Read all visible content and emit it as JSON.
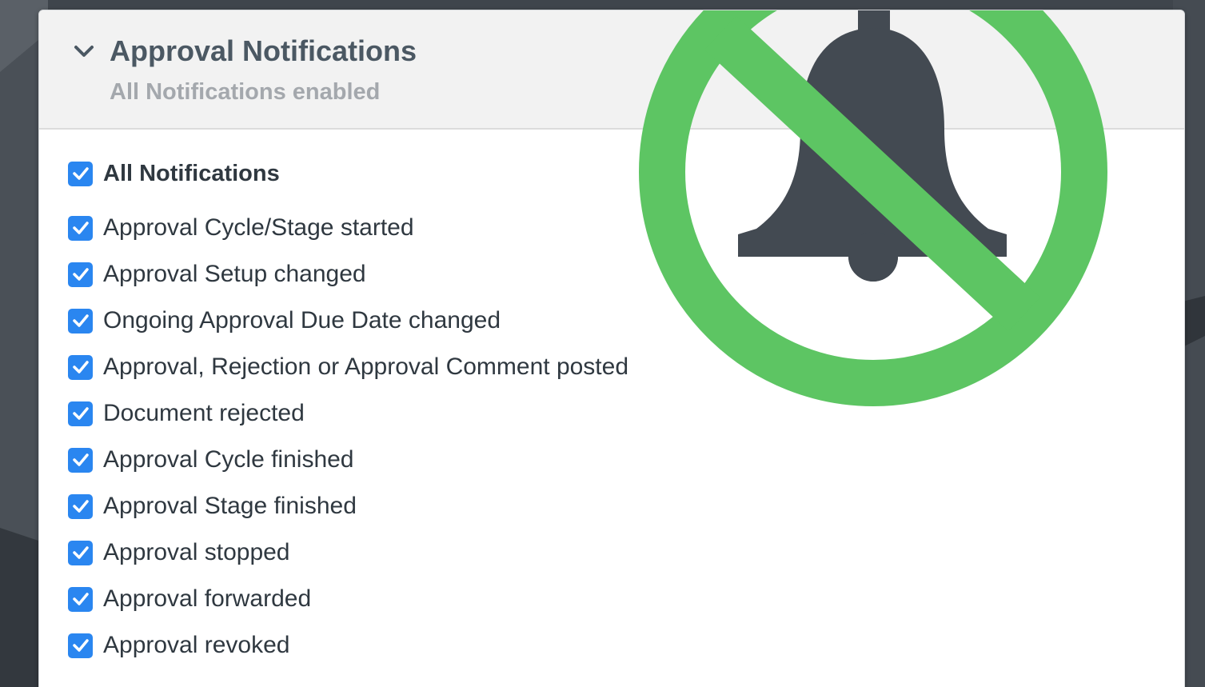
{
  "panel": {
    "title": "Approval Notifications",
    "subtitle": "All Notifications enabled",
    "collapse_icon": "chevron-down-icon"
  },
  "notifications": [
    {
      "label": "All Notifications",
      "checked": true,
      "bold": true
    },
    {
      "label": "Approval Cycle/Stage started",
      "checked": true
    },
    {
      "label": "Approval Setup changed",
      "checked": true
    },
    {
      "label": "Ongoing Approval Due Date changed",
      "checked": true
    },
    {
      "label": "Approval, Rejection or Approval Comment posted",
      "checked": true
    },
    {
      "label": "Document rejected",
      "checked": true
    },
    {
      "label": "Approval Cycle finished",
      "checked": true
    },
    {
      "label": "Approval Stage finished",
      "checked": true
    },
    {
      "label": "Approval stopped",
      "checked": true
    },
    {
      "label": "Approval forwarded",
      "checked": true
    },
    {
      "label": "Approval revoked",
      "checked": true
    }
  ],
  "overlay": {
    "icon": "bell-disabled-icon"
  },
  "colors": {
    "checkbox": "#2a86f0",
    "prohibition_ring": "#5dc563",
    "bell": "#434a52",
    "background": "#3f454c"
  }
}
